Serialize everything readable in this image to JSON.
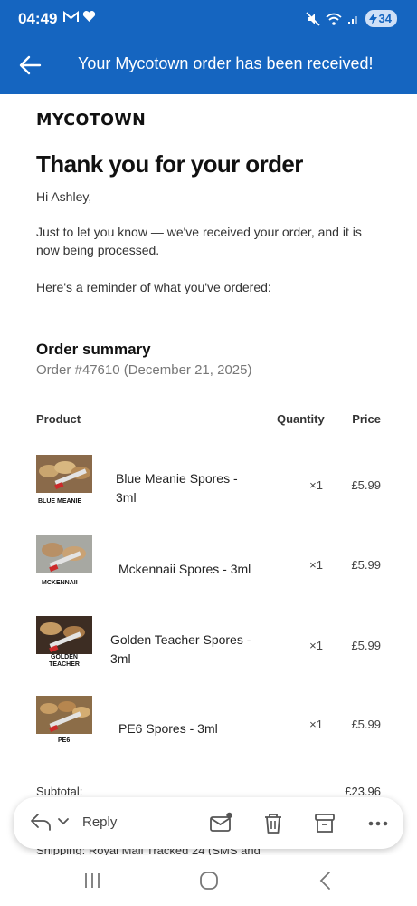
{
  "status_bar": {
    "time": "04:49",
    "battery": "34",
    "icons": [
      "gmail-icon",
      "heart-icon",
      "mute-icon",
      "wifi-icon",
      "signal-icon",
      "battery-charging-icon"
    ]
  },
  "app_bar": {
    "title": "Your Mycotown order has been received!",
    "back_icon": "back-arrow-icon"
  },
  "email": {
    "brand_logo": "MYCOTOWN",
    "heading": "Thank you for your order",
    "greeting": "Hi Ashley,",
    "body": "Just to let you know — we've received your order, and it is now being processed.",
    "reminder": "Here's a reminder of what you've ordered:",
    "summary_title": "Order summary",
    "order_line": "Order #47610 (December 21, 2025)",
    "table_headers": {
      "product": "Product",
      "quantity": "Quantity",
      "price": "Price"
    },
    "items": [
      {
        "name": "Blue Meanie Spores - 3ml",
        "qty": "×1",
        "price": "£5.99",
        "thumb_label": "BLUE MEANIE"
      },
      {
        "name": "Mckennaii Spores - 3ml",
        "qty": "×1",
        "price": "£5.99",
        "thumb_label": "MCKENNAII"
      },
      {
        "name": "Golden Teacher Spores - 3ml",
        "qty": "×1",
        "price": "£5.99",
        "thumb_label": "GOLDEN TEACHER"
      },
      {
        "name": "PE6 Spores - 3ml",
        "qty": "×1",
        "price": "£5.99",
        "thumb_label": "PE6"
      }
    ],
    "subtotal_label": "Subtotal:",
    "subtotal_value": "£23.96",
    "shipping_partial": "Shipping: Royal Mail Tracked 24 (SMS and"
  },
  "action_bar": {
    "reply_label": "Reply",
    "icons": [
      "reply-icon",
      "chevron-down-icon",
      "mark-unread-icon",
      "delete-icon",
      "archive-icon",
      "more-icon"
    ]
  },
  "nav_bar": {
    "icons": [
      "recents-icon",
      "home-icon",
      "back-icon"
    ]
  },
  "colors": {
    "primary": "#1565c0",
    "background": "#ffffff",
    "text": "#222222",
    "muted": "#777777"
  }
}
